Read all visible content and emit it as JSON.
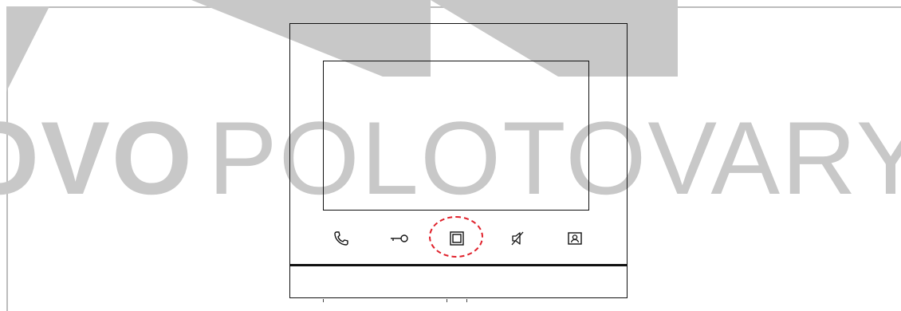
{
  "watermark": {
    "prefix": "OVO",
    "suffix": "POLOTOVARY",
    "color": "#c8c8c8"
  },
  "device": {
    "buttons": [
      {
        "name": "call-button",
        "icon": "phone-icon"
      },
      {
        "name": "unlock-button",
        "icon": "key-icon"
      },
      {
        "name": "monitor-button",
        "icon": "monitor-square-icon"
      },
      {
        "name": "mute-button",
        "icon": "speaker-mute-icon"
      },
      {
        "name": "intercom-button",
        "icon": "user-card-icon"
      }
    ],
    "highlighted_button": "monitor-button",
    "highlight_color": "#e0202a"
  }
}
